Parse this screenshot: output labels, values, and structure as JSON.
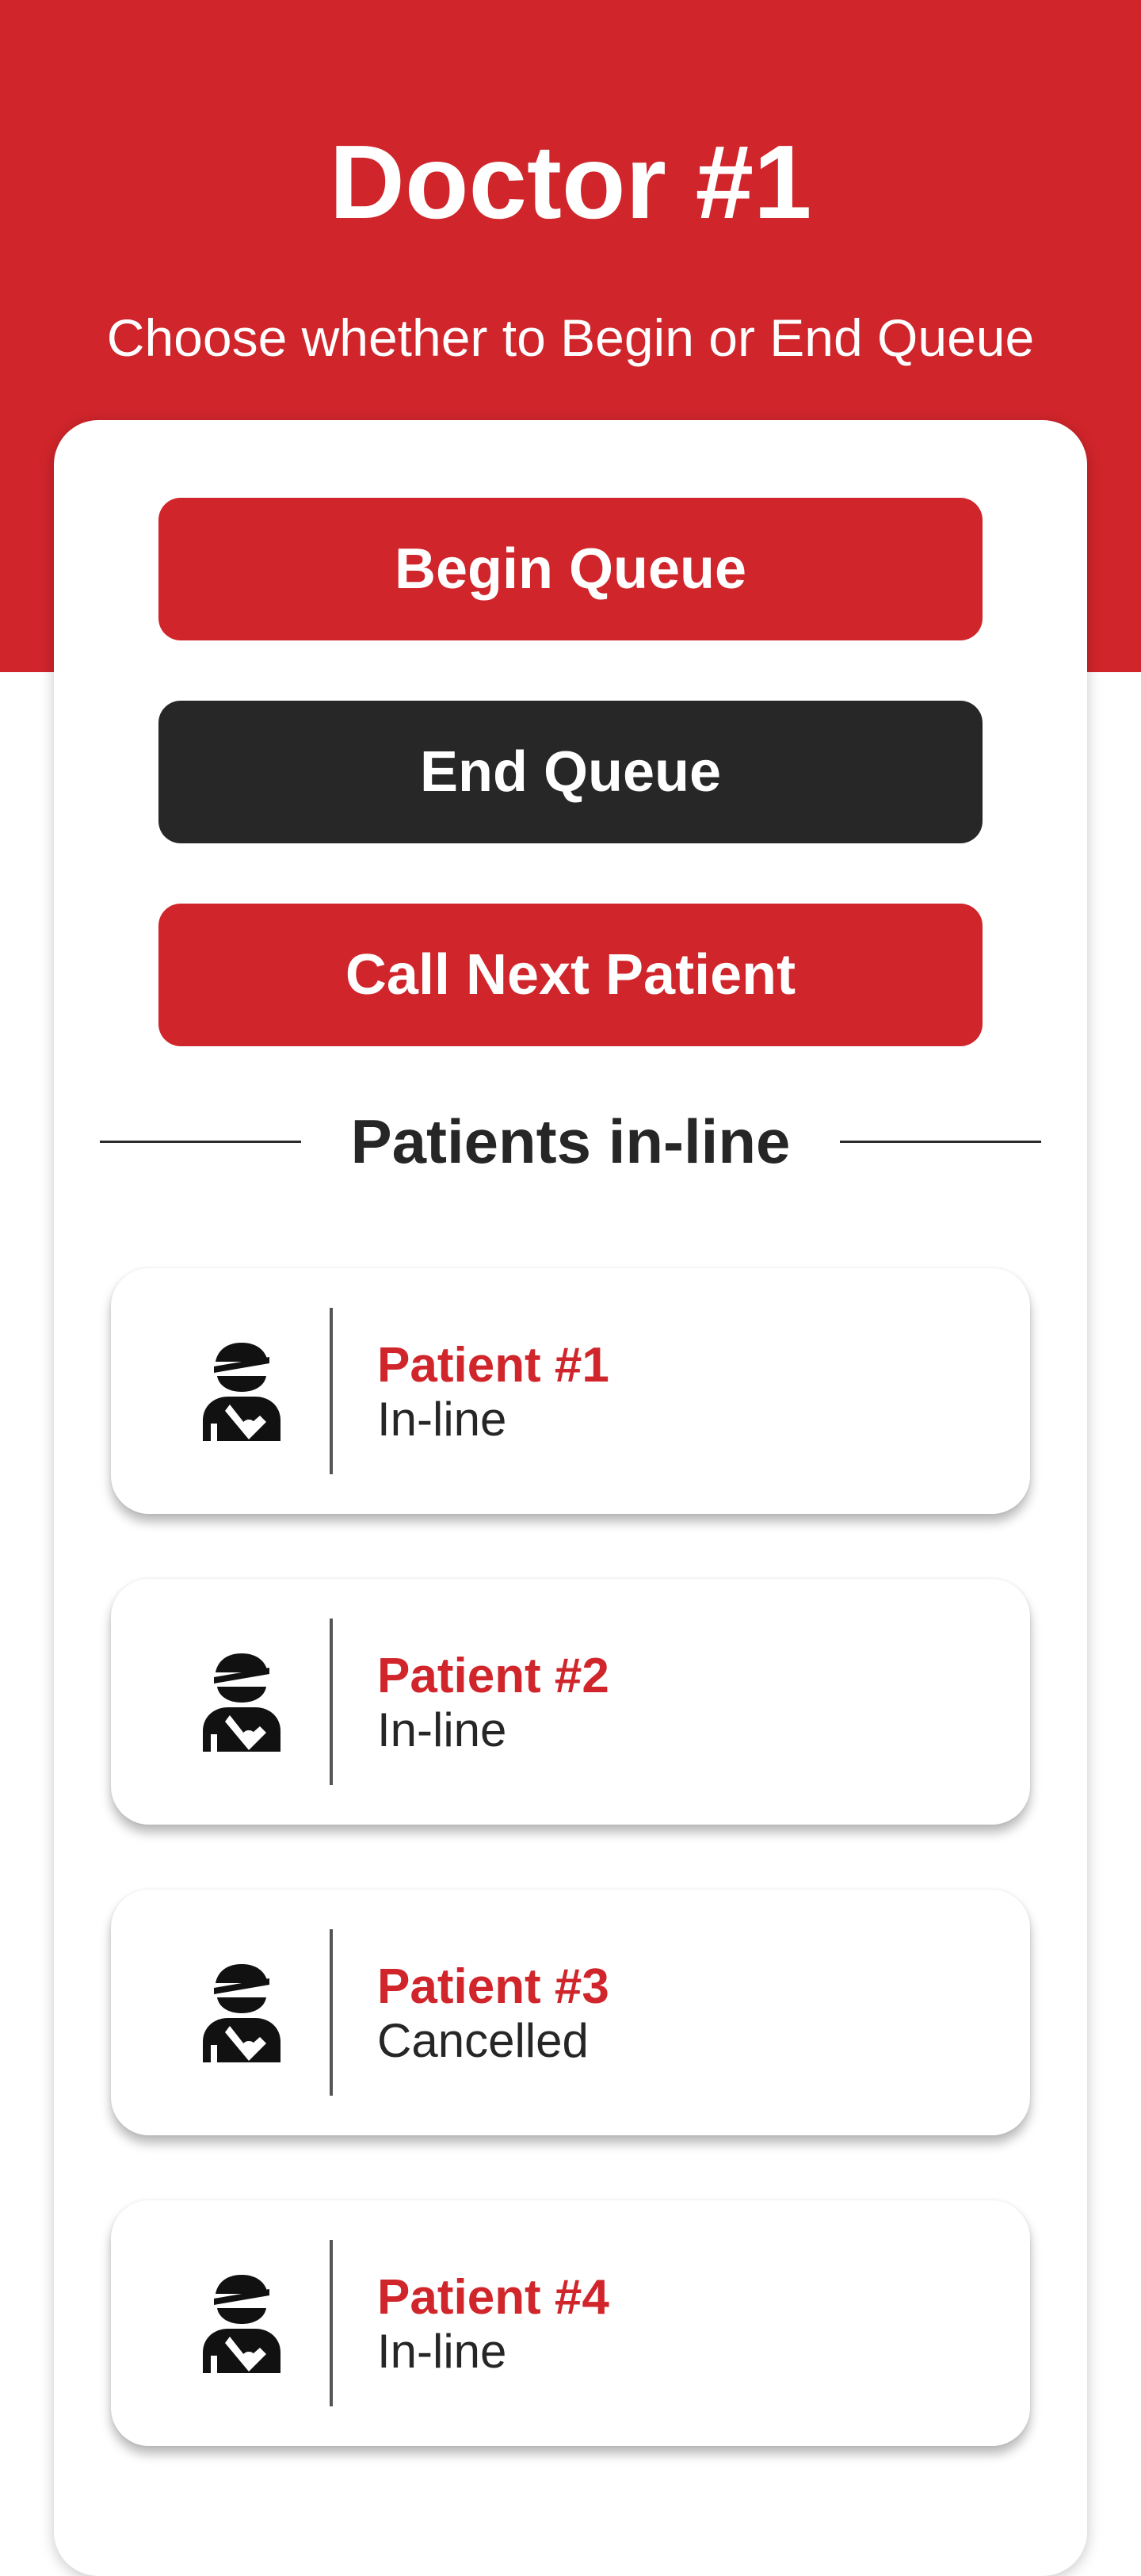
{
  "header": {
    "title": "Doctor #1",
    "subtitle": "Choose whether to Begin or End Queue"
  },
  "actions": {
    "begin_label": "Begin Queue",
    "end_label": "End Queue",
    "next_label": "Call Next Patient"
  },
  "section": {
    "title": "Patients in-line"
  },
  "patients": [
    {
      "name": "Patient #1",
      "status": "In-line",
      "icon": "injured-patient-icon"
    },
    {
      "name": "Patient #2",
      "status": "In-line",
      "icon": "injured-patient-icon"
    },
    {
      "name": "Patient #3",
      "status": "Cancelled",
      "icon": "injured-patient-icon"
    },
    {
      "name": "Patient #4",
      "status": "In-line",
      "icon": "injured-patient-icon"
    }
  ],
  "colors": {
    "brand_red": "#d0252b",
    "dark_button": "#272727",
    "text_dark": "#262626"
  }
}
